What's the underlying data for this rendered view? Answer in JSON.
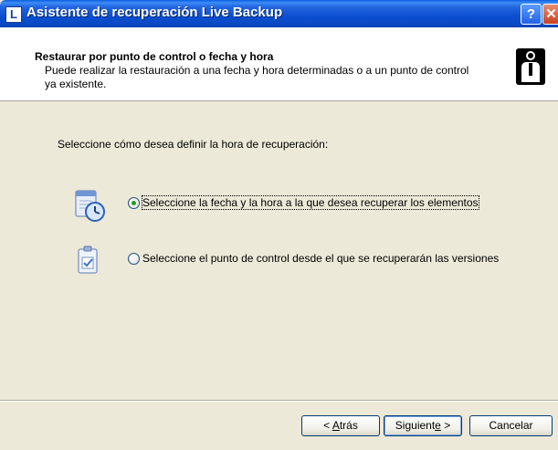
{
  "window": {
    "title": "Asistente de recuperación Live Backup",
    "app_icon_letter": "L",
    "help_button": "?",
    "close_button": "✕"
  },
  "header": {
    "title": "Restaurar por punto de control o fecha y hora",
    "description": "Puede realizar la restauración a una fecha y hora determinadas o a un punto de control ya existente."
  },
  "body": {
    "prompt": "Seleccione cómo desea definir la hora de recuperación:",
    "options": [
      {
        "label": "Seleccione la fecha y la hora a la que desea recuperar los elementos",
        "selected": true,
        "icon": "calendar-clock-icon"
      },
      {
        "label": "Seleccione el punto de control desde el que se recuperarán las versiones",
        "selected": false,
        "icon": "checkpoint-document-icon"
      }
    ]
  },
  "buttons": {
    "back": {
      "before": "< ",
      "mnemonic": "A",
      "after": "trás"
    },
    "next": {
      "before": "Siguient",
      "mnemonic": "e",
      "after": " >"
    },
    "cancel": "Cancelar"
  },
  "colors": {
    "titlebar": "#0a4fcf",
    "window_bg": "#ece9d8",
    "header_bg": "#ffffff",
    "radio_dot": "#21a121"
  }
}
